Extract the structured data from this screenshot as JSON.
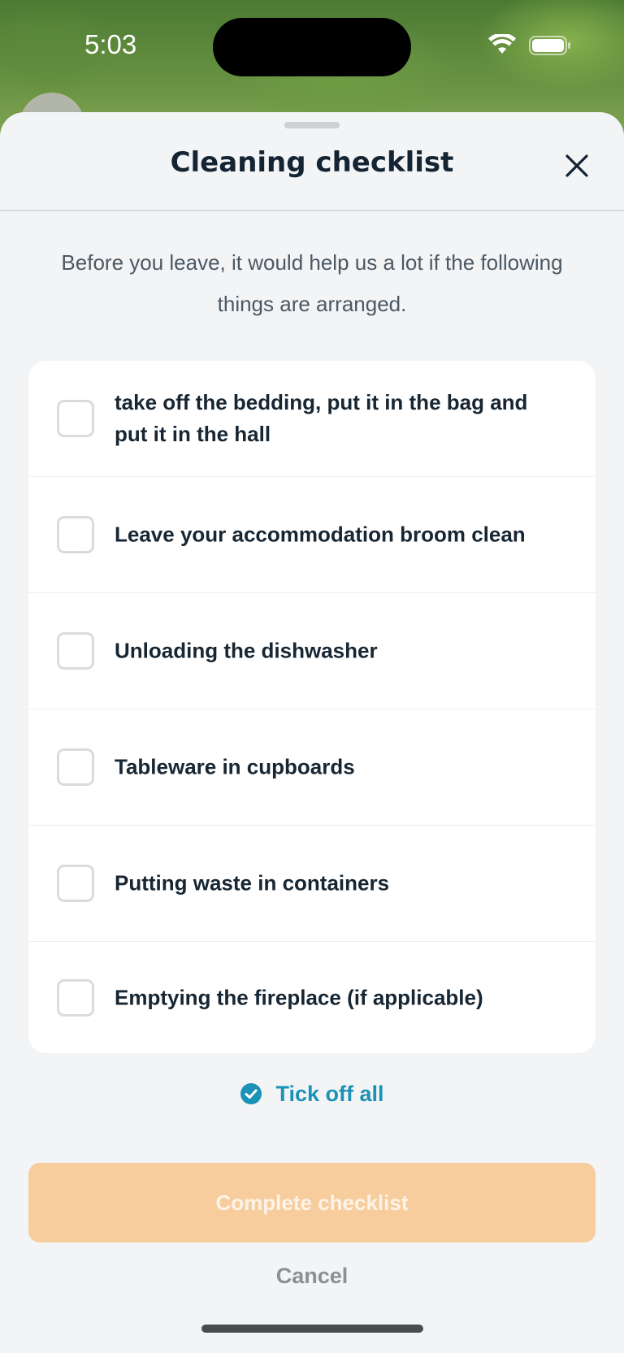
{
  "status_bar": {
    "time": "5:03"
  },
  "sheet": {
    "title": "Cleaning checklist",
    "intro": "Before you leave, it would help us a lot if the following things are arranged."
  },
  "checklist": {
    "items": [
      {
        "label": "take off the bedding, put it in the bag and put it in the hall",
        "checked": false
      },
      {
        "label": "Leave your accommodation broom clean",
        "checked": false
      },
      {
        "label": "Unloading the dishwasher",
        "checked": false
      },
      {
        "label": "Tableware in cupboards",
        "checked": false
      },
      {
        "label": "Putting waste in containers",
        "checked": false
      },
      {
        "label": "Emptying the fireplace (if applicable)",
        "checked": false
      }
    ]
  },
  "actions": {
    "tick_all_label": "Tick off all",
    "complete_label": "Complete checklist",
    "cancel_label": "Cancel"
  },
  "colors": {
    "accent": "#1b92b6",
    "primary_disabled": "#f7cd9e",
    "sheet_background": "#f2f4f6",
    "title_text": "#142433"
  },
  "icons": {
    "close": "close-icon",
    "tick_all": "check-circle-icon",
    "wifi": "wifi-icon",
    "battery": "battery-icon"
  }
}
